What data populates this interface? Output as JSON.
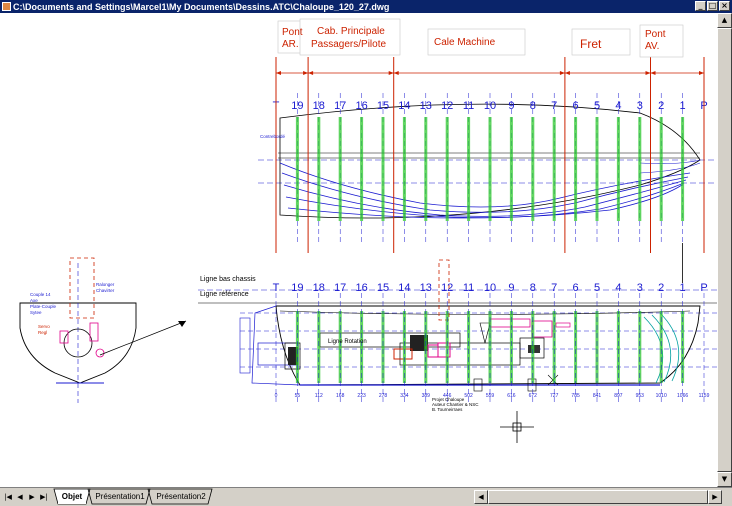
{
  "window": {
    "title": "C:\\Documents and Settings\\Marcel1\\My Documents\\Dessins.ATC\\Chaloupe_120_27.dwg",
    "minimize_glyph": "_",
    "maximize_glyph": "□",
    "close_glyph": "×"
  },
  "zones": {
    "pont_ar": [
      "Pont",
      "AR."
    ],
    "cab": [
      "Cab. Principale",
      "Passagers/Pilote"
    ],
    "cale": "Cale Machine",
    "fret": "Fret",
    "pont_av": [
      "Pont",
      "AV."
    ]
  },
  "stations": [
    "T",
    "19",
    "18",
    "17",
    "16",
    "15",
    "14",
    "13",
    "12",
    "11",
    "10",
    "9",
    "8",
    "7",
    "6",
    "5",
    "4",
    "3",
    "2",
    "1",
    "P"
  ],
  "labels": {
    "contrebordé": "Contrebordé",
    "ligne_bas_chassis": "Ligne bas chassis",
    "ligne_reference": "Ligne référence",
    "ligne_rotation": "Ligne Rotation",
    "section_notes": [
      "Couple 14",
      "Axe",
      "Plate-Couple",
      "Sytee",
      "Servo",
      "Regl",
      "Ralonger",
      "Chavirter"
    ],
    "projet": [
      "Projet Chaloupe",
      "Auteur Chantier & NSC",
      "B. Tourneirraes"
    ]
  },
  "dimensions": [
    "0",
    "55",
    "112",
    "168",
    "223",
    "278",
    "334",
    "389",
    "446",
    "502",
    "559",
    "616",
    "672",
    "727",
    "785",
    "841",
    "897",
    "953",
    "1010",
    "1066",
    "1159"
  ],
  "tabs": [
    "Objet",
    "Présentation1",
    "Présentation2"
  ],
  "nav": [
    "|◀",
    "◀",
    "▶",
    "▶|"
  ],
  "scroll_glyphs": {
    "up": "▲",
    "down": "▼",
    "left": "◀",
    "right": "▶"
  },
  "colors": {
    "titlebar": "#0a246a",
    "frame": "#d4d0c8",
    "station_blue": "#1a1ad0",
    "station_green": "#2cc82c",
    "zone_red": "#cc2200",
    "hull": "#00a0a0",
    "magenta": "#e0008a",
    "canvas": "#ffffff"
  }
}
